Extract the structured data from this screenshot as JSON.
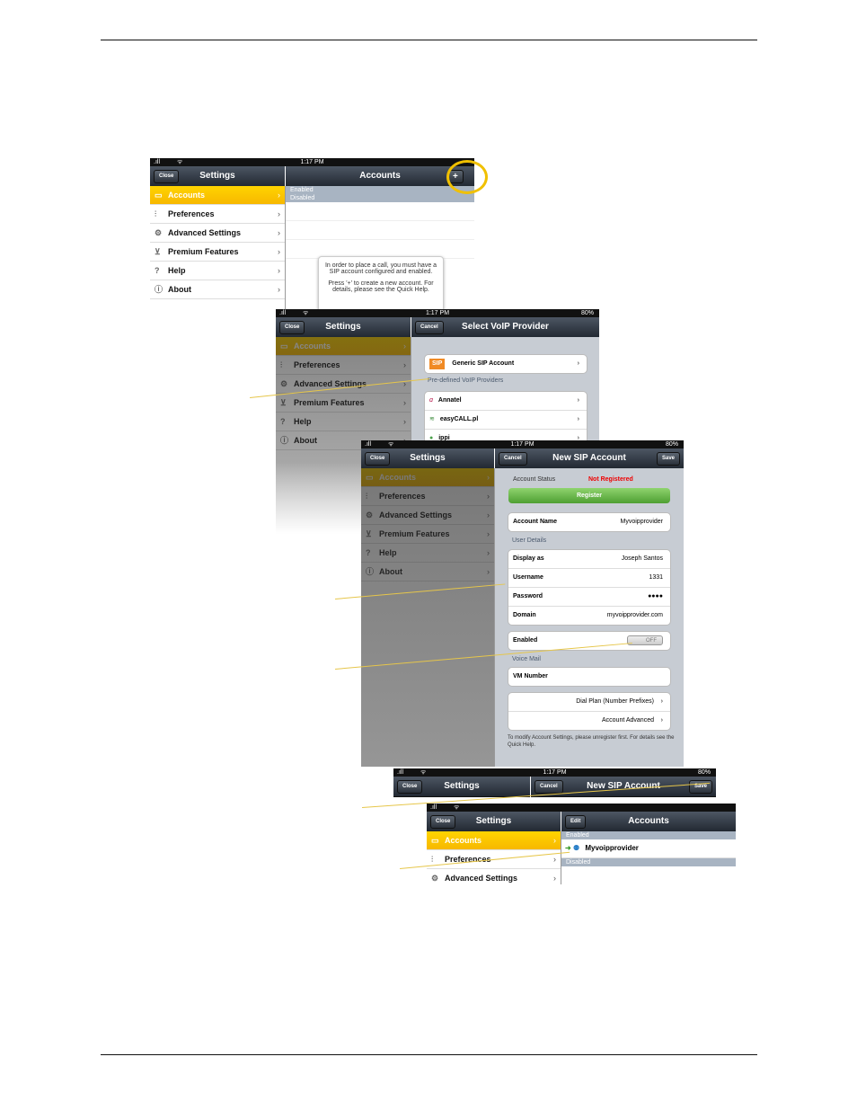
{
  "status": {
    "time": "1:17 PM",
    "battery": "80%",
    "signal": ".ıll",
    "wifi": "ᯤ"
  },
  "sidebar": {
    "title": "Settings",
    "close": "Close",
    "items": [
      {
        "label": "Accounts",
        "icon": "accounts-icon"
      },
      {
        "label": "Preferences",
        "icon": "preferences-icon"
      },
      {
        "label": "Advanced Settings",
        "icon": "gears-icon"
      },
      {
        "label": "Premium Features",
        "icon": "cart-icon"
      },
      {
        "label": "Help",
        "icon": "help-icon"
      },
      {
        "label": "About",
        "icon": "info-icon"
      }
    ]
  },
  "shot1": {
    "title": "Accounts",
    "add": "+",
    "enabled": "Enabled",
    "disabled": "Disabled",
    "notice": "In order to place a call, you must have a SIP account configured and enabled.",
    "notice2": "Press '+' to create a new account. For details, please see the Quick Help."
  },
  "shot2": {
    "title": "Select VoIP Provider",
    "cancel": "Cancel",
    "generic": "Generic SIP Account",
    "sip_badge": "SIP",
    "predefined": "Pre-defined VoIP Providers",
    "providers": [
      "Annatel",
      "easyCALL.pl",
      "ippi"
    ]
  },
  "shot3": {
    "title": "New SIP Account",
    "cancel": "Cancel",
    "save": "Save",
    "status_label": "Account Status",
    "status_value": "Not Registered",
    "register": "Register",
    "account_name_label": "Account Name",
    "account_name": "Myvoipprovider",
    "user_details": "User Details",
    "display_as_label": "Display as",
    "display_as": "Joseph Santos",
    "username_label": "Username",
    "username": "1331",
    "password_label": "Password",
    "password": "●●●●",
    "domain_label": "Domain",
    "domain": "myvoipprovider.com",
    "enabled_label": "Enabled",
    "toggle": "OFF",
    "voice_mail": "Voice Mail",
    "vm_number": "VM Number",
    "dial_plan": "Dial Plan (Number Prefixes)",
    "account_advanced": "Account Advanced",
    "footer": "To modify Account Settings, please unregister first. For details see the Quick Help."
  },
  "shot4": {
    "title": "Settings",
    "close": "Close",
    "cancel": "Cancel",
    "right_title": "New SIP Account",
    "save": "Save"
  },
  "shot5": {
    "title": "Settings",
    "close": "Close",
    "edit": "Edit",
    "right_title": "Accounts",
    "enabled": "Enabled",
    "account": "Myvoipprovider",
    "disabled": "Disabled"
  }
}
